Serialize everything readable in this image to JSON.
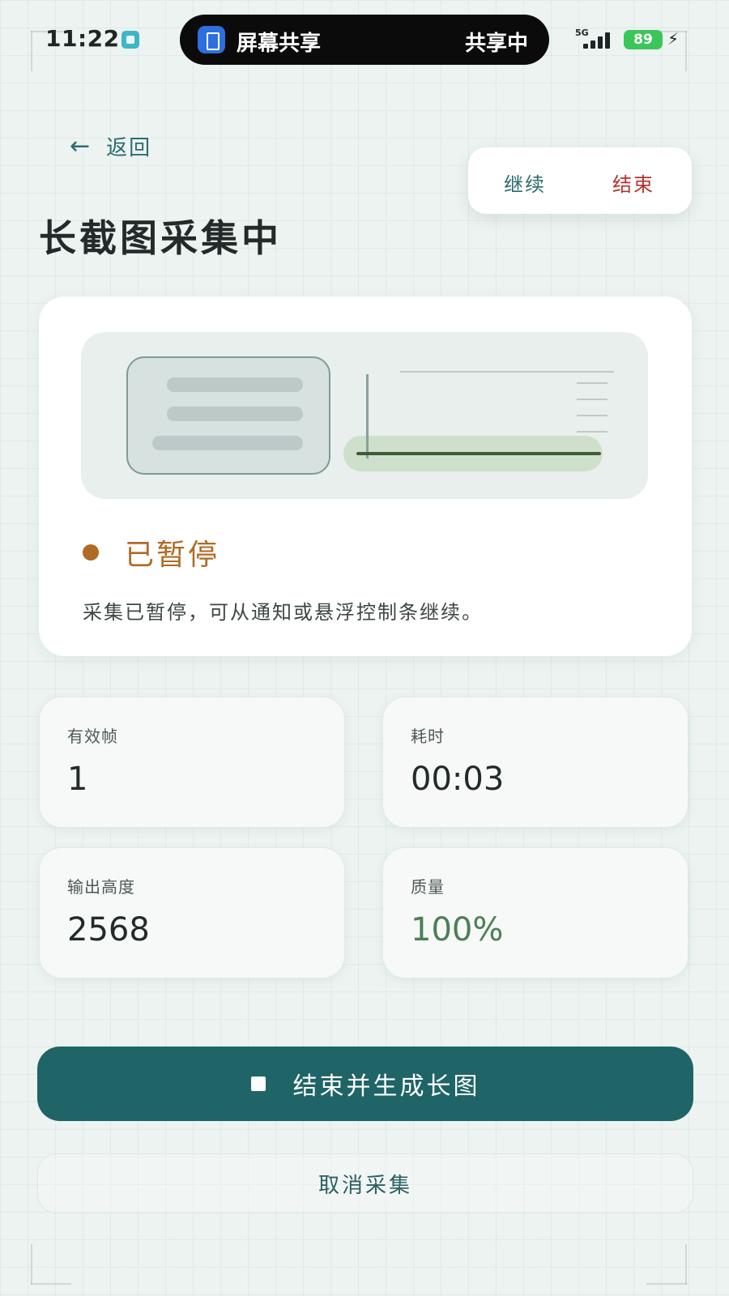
{
  "status_bar": {
    "time": "11:22",
    "share_title": "屏幕共享",
    "share_state": "共享中",
    "network": "5G",
    "battery": "89"
  },
  "header": {
    "back_label": "返回",
    "title": "长截图采集中"
  },
  "float_control": {
    "continue_label": "继续",
    "end_label": "结束"
  },
  "status": {
    "label": "已暂停",
    "description": "采集已暂停，可从通知或悬浮控制条继续。"
  },
  "stats": [
    {
      "label": "有效帧",
      "value": "1"
    },
    {
      "label": "耗时",
      "value": "00:03"
    },
    {
      "label": "输出高度",
      "value": "2568"
    },
    {
      "label": "质量",
      "value": "100%"
    }
  ],
  "actions": {
    "primary_label": "结束并生成长图",
    "secondary_label": "取消采集"
  },
  "colors": {
    "primary": "#1f6467",
    "paused": "#b06a23",
    "end": "#b3322f",
    "quality": "#4d7e55"
  }
}
